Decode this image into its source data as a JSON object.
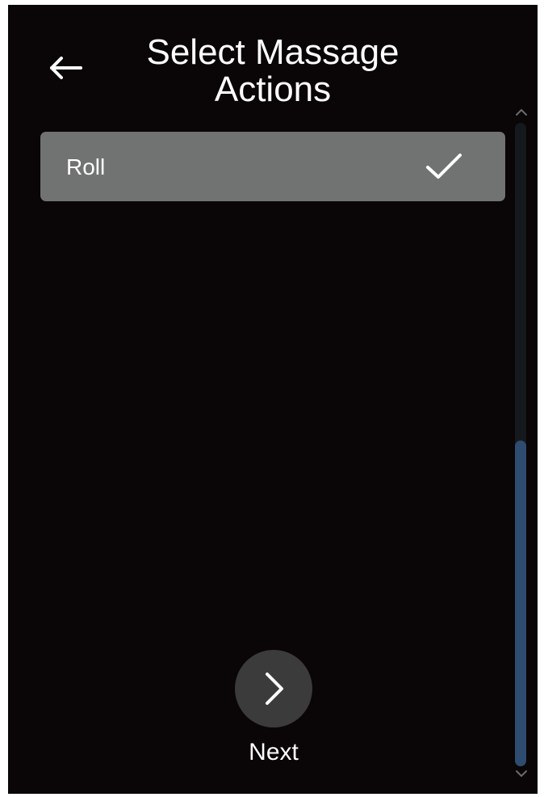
{
  "header": {
    "title": "Select Massage Actions",
    "back_icon": "arrow-left-icon"
  },
  "actions": {
    "items": [
      {
        "label": "Roll",
        "selected": true,
        "icon": "check-icon"
      }
    ]
  },
  "footer": {
    "next_label": "Next",
    "next_icon": "chevron-right-icon"
  },
  "colors": {
    "background": "#0a0506",
    "item_selected": "#717372",
    "scroll_thumb": "#2e4b70",
    "next_button": "#3b3b3b",
    "text": "#ffffff"
  }
}
